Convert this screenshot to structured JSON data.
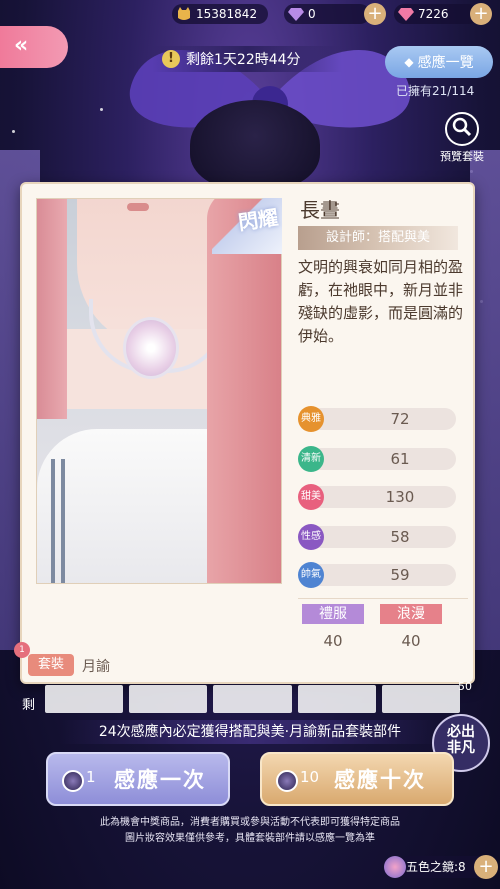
{
  "header": {
    "back_icon": "back-arrow-icon",
    "gold": "15381842",
    "diamond": "0",
    "stardiamond": "7226",
    "countdown": "剩餘1天22時44分",
    "catalog_label": "感應一覽",
    "owned_text": "已擁有21/114",
    "preview_label": "預覽套裝"
  },
  "item": {
    "badge": "閃耀",
    "name": "長晝",
    "designer": "設計師：搭配與美",
    "description": "文明的興衰如同月相的盈虧，在祂眼中，新月並非殘缺的虛影，而是圓滿的伊始。",
    "stats": [
      {
        "label": "典雅",
        "value": "72",
        "color": "#e6922e"
      },
      {
        "label": "清新",
        "value": "61",
        "color": "#3bb68a"
      },
      {
        "label": "甜美",
        "value": "130",
        "color": "#e8607e"
      },
      {
        "label": "性感",
        "value": "58",
        "color": "#8a58c2"
      },
      {
        "label": "帥氣",
        "value": "59",
        "color": "#4f84d2"
      }
    ],
    "tags": [
      {
        "label": "禮服",
        "value": "40",
        "color": "#b48ad8"
      },
      {
        "label": "浪漫",
        "value": "40",
        "color": "#e6818a"
      }
    ],
    "set_label": "套裝",
    "set_name": "月諭"
  },
  "bottom": {
    "left_num": "剩",
    "right_num": "50",
    "badge_num": "1",
    "banner": "24次感應內必定獲得搭配與美·月諭新品套裝部件",
    "stamp_line1": "必出",
    "stamp_line2": "非凡",
    "draw_once": {
      "count": "1",
      "label": "感應一次"
    },
    "draw_ten": {
      "count": "10",
      "label": "感應十次"
    },
    "notice_1": "此為機會中獎商品，消費者購買或參與活動不代表即可獲得特定商品",
    "notice_2": "圖片妝容效果僅供參考，具體套裝部件請以感應一覽為準",
    "mirror": "五色之鏡:8"
  }
}
